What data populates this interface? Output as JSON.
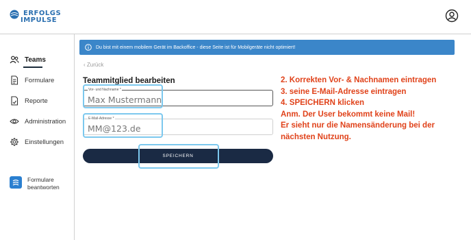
{
  "header": {
    "logo_line1": "ERFOLGS",
    "logo_line2": "IMPULSE",
    "user_icon": "user-circle-icon"
  },
  "sidebar": {
    "items": [
      {
        "label": "Teams",
        "icon": "users-icon",
        "active": true
      },
      {
        "label": "Formulare",
        "icon": "document-icon",
        "active": false
      },
      {
        "label": "Reporte",
        "icon": "report-icon",
        "active": false
      },
      {
        "label": "Administration",
        "icon": "eye-icon",
        "active": false
      },
      {
        "label": "Einstellungen",
        "icon": "gear-icon",
        "active": false
      }
    ],
    "forms_answer_label": "Formulare beantworten"
  },
  "banner": {
    "text": "Du bist mit einem mobilem Gerät im Backoffice - diese Seite ist für Mobilgeräte nicht optimiert!"
  },
  "back_link": "‹  Zurück",
  "form": {
    "title": "Teammitglied bearbeiten",
    "name_label": "Vor- und Nachname *",
    "name_value": "Max Mustermann",
    "email_label": "E-Mail-Adresse *",
    "email_value": "MM@123.de",
    "save_label": "SPEICHERN"
  },
  "instructions": [
    "2. Korrekten Vor- & Nachnamen eintragen",
    "3. seine E-Mail-Adresse eintragen",
    "4. SPEICHERN klicken",
    "Anm. Der User bekommt keine Mail!",
    "Er sieht nur die Namensänderung bei der",
    "nächsten Nutzung."
  ],
  "colors": {
    "accent": "#3b86c9",
    "button": "#1a2a44",
    "annotation": "#e0421a",
    "highlight": "#7cc8ee"
  }
}
